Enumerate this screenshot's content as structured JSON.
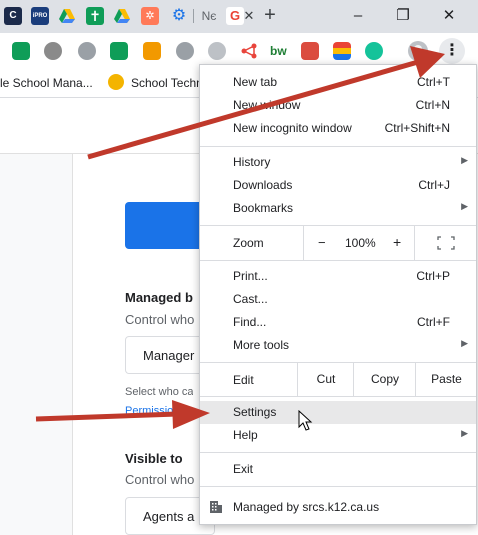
{
  "tab_strip": {
    "new_tab_symbol": "+",
    "tab_partial": "Nє",
    "window_controls": {
      "minimize": "–",
      "restore": "❐",
      "close": "✕"
    }
  },
  "bookmarks": [
    {
      "label": "le School Mana..."
    },
    {
      "label": "School Techn"
    }
  ],
  "menu": {
    "items": {
      "new_tab": {
        "label": "New tab",
        "shortcut": "Ctrl+T"
      },
      "new_window": {
        "label": "New window",
        "shortcut": "Ctrl+N"
      },
      "new_incognito": {
        "label": "New incognito window",
        "shortcut": "Ctrl+Shift+N"
      },
      "history": {
        "label": "History"
      },
      "downloads": {
        "label": "Downloads",
        "shortcut": "Ctrl+J"
      },
      "bookmarks": {
        "label": "Bookmarks"
      },
      "print": {
        "label": "Print...",
        "shortcut": "Ctrl+P"
      },
      "cast": {
        "label": "Cast..."
      },
      "find": {
        "label": "Find...",
        "shortcut": "Ctrl+F"
      },
      "more_tools": {
        "label": "More tools"
      },
      "settings": {
        "label": "Settings"
      },
      "help": {
        "label": "Help"
      },
      "exit": {
        "label": "Exit"
      }
    },
    "zoom": {
      "label": "Zoom",
      "minus": "−",
      "value": "100%",
      "plus": "+"
    },
    "edit": {
      "label": "Edit",
      "cut": "Cut",
      "copy": "Copy",
      "paste": "Paste"
    },
    "managed": "Managed by srcs.k12.ca.us"
  },
  "page": {
    "managed_heading": "Managed b",
    "managed_sub": "Control who",
    "manager_box": "Manager",
    "select_text": "Select who ca",
    "permissions_link": "Permissio",
    "visible_heading": "Visible to",
    "visible_sub": "Control who",
    "agents_box": "Agents a"
  },
  "colors": {
    "accent": "#1a73e8",
    "annotation_arrow": "#c0392b",
    "menu_highlight": "#e8e8e9"
  }
}
